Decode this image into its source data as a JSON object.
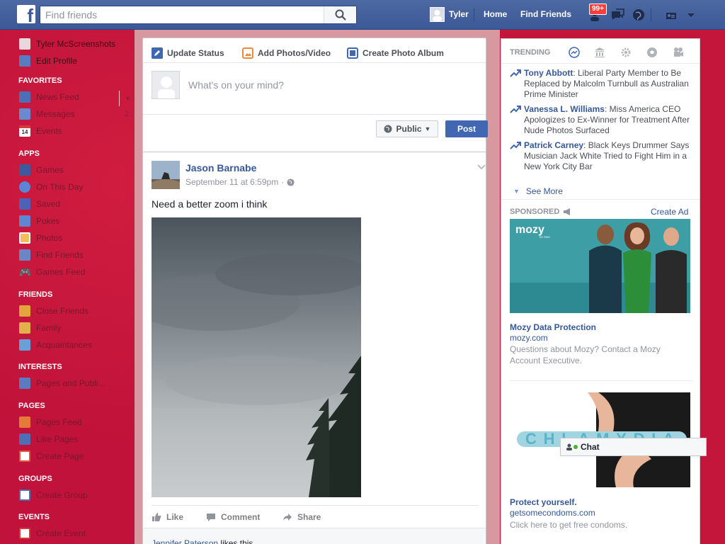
{
  "topbar": {
    "search_placeholder": "Find friends",
    "user_name": "Tyler",
    "home_label": "Home",
    "find_friends_label": "Find Friends",
    "notifications_badge": "99+"
  },
  "sidebar": {
    "profile_name": "Tyler McScreenshots",
    "edit_profile": "Edit Profile",
    "favorites_heading": "FAVORITES",
    "favorites": [
      {
        "label": "News Feed",
        "count": ""
      },
      {
        "label": "Messages",
        "count": "2"
      },
      {
        "label": "Events",
        "count": ""
      }
    ],
    "events_icon_day": "14",
    "apps_heading": "APPS",
    "apps": [
      "Games",
      "On This Day",
      "Saved",
      "Pokes",
      "Photos",
      "Find Friends",
      "Games Feed"
    ],
    "friends_heading": "FRIENDS",
    "friends": [
      "Close Friends",
      "Family",
      "Acquaintances"
    ],
    "interests_heading": "INTERESTS",
    "interests": [
      "Pages and Publi..."
    ],
    "pages_heading": "PAGES",
    "pages": [
      "Pages Feed",
      "Like Pages",
      "Create Page"
    ],
    "groups_heading": "GROUPS",
    "groups": [
      "Create Group"
    ],
    "events_heading": "EVENTS",
    "events": [
      "Create Event"
    ]
  },
  "composer": {
    "tab_update_status": "Update Status",
    "tab_add_photos": "Add Photos/Video",
    "tab_create_album": "Create Photo Album",
    "placeholder": "What's on your mind?",
    "audience_label": "Public",
    "post_label": "Post"
  },
  "story": {
    "author": "Jason Barnabe",
    "timestamp": "September 11 at 6:59pm",
    "meta_separator": "·",
    "text": "Need a better zoom i think",
    "like_label": "Like",
    "comment_label": "Comment",
    "share_label": "Share",
    "liker_name": "Jennifer Paterson",
    "likes_suffix": " likes this."
  },
  "trending": {
    "heading": "TRENDING",
    "items": [
      {
        "name": "Tony Abbott",
        "desc": ": Liberal Party Member to Be Replaced by Malcolm Turnbull as Australian Prime Minister"
      },
      {
        "name": "Vanessa L. Williams",
        "desc": ": Miss America CEO Apologizes to Ex-Winner for Treatment After Nude Photos Surfaced"
      },
      {
        "name": "Patrick Carney",
        "desc": ": Black Keys Drummer Says Musician Jack White Tried to Fight Him in a New York City Bar"
      }
    ],
    "see_more": "See More"
  },
  "sponsored": {
    "heading": "SPONSORED",
    "create_ad": "Create Ad",
    "ads": [
      {
        "brand_logo": "mozy",
        "brand_sub": "BY EMC",
        "title": "Mozy Data Protection",
        "url": "mozy.com",
        "desc": "Questions about Mozy? Contact a Mozy Account Executive."
      },
      {
        "image_text": "CHLAMYDIA",
        "title": "Protect yourself.",
        "url": "getsomecondoms.com",
        "desc": "Click here to get free condoms."
      }
    ]
  },
  "chat": {
    "label": "Chat"
  },
  "colors": {
    "facebook_blue": "#3b5998",
    "sidebar_red": "#c4163a",
    "link_blue": "#365899",
    "post_button": "#4267b2",
    "badge_red": "#fa3e3e"
  }
}
